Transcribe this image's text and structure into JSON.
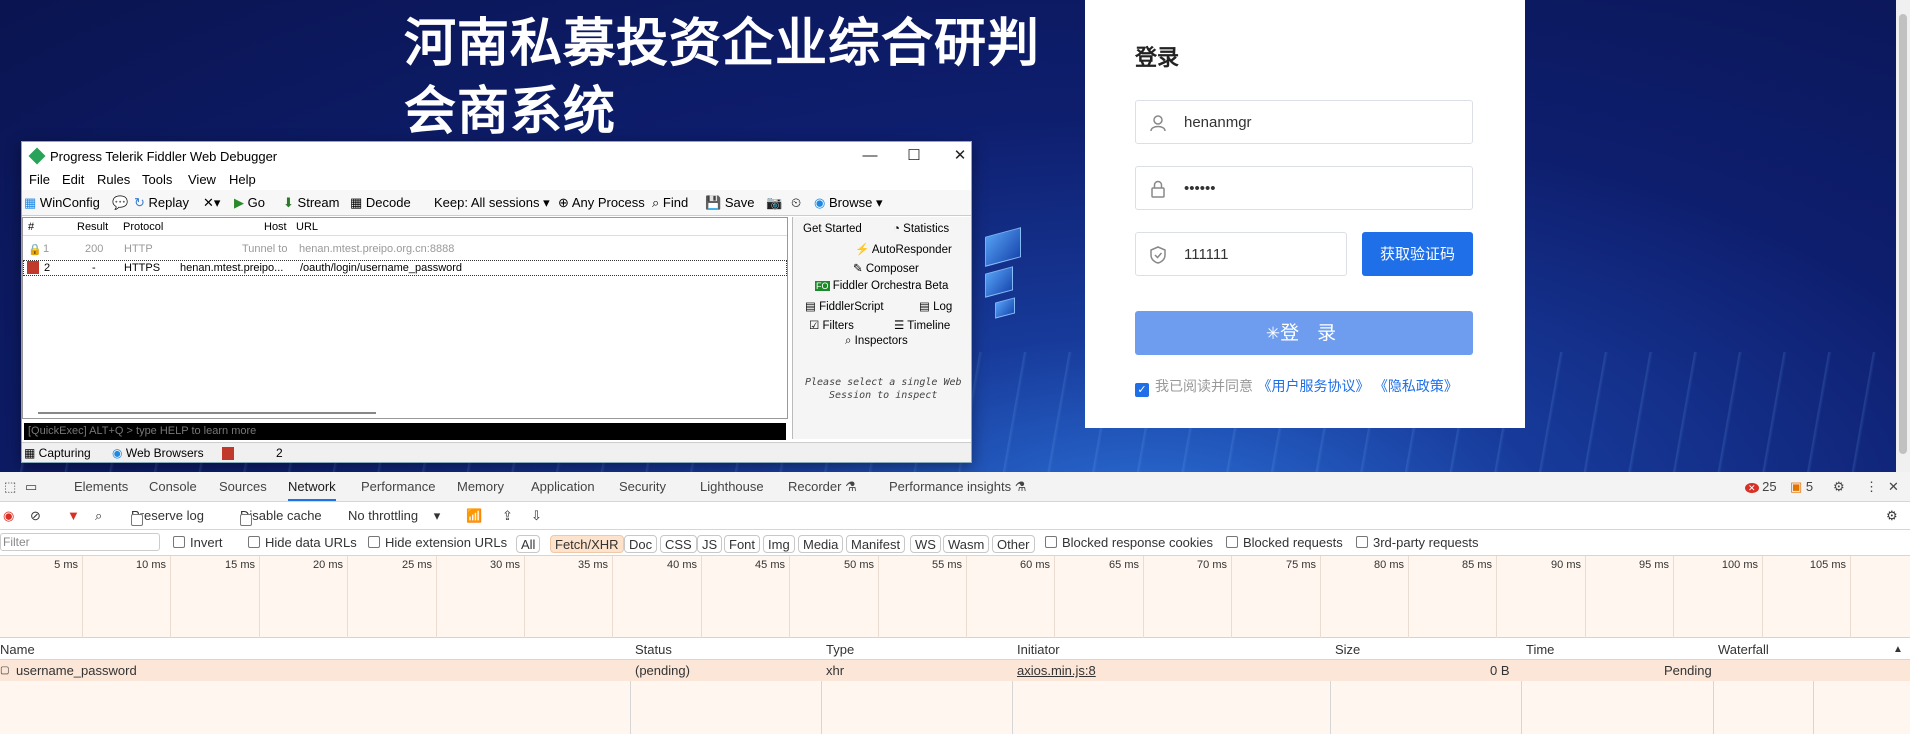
{
  "site": {
    "title_line1": "河南私募投资企业综合研判",
    "title_line2": "会商系统",
    "login": {
      "title": "登录",
      "username": "henanmgr",
      "password": "••••••",
      "captcha": "111111",
      "get_code_label": "获取验证码",
      "login_label": "登 录",
      "agree_text": "我已阅读并同意",
      "agreement_link": "《用户服务协议》",
      "privacy_link": "《隐私政策》"
    }
  },
  "fiddler": {
    "title": "Progress Telerik Fiddler Web Debugger",
    "menu": [
      "File",
      "Edit",
      "Rules",
      "Tools",
      "View",
      "Help"
    ],
    "toolbar": {
      "winconfig": "WinConfig",
      "replay": "Replay",
      "go": "Go",
      "stream": "Stream",
      "decode": "Decode",
      "keep": "Keep: All sessions",
      "any_process": "Any Process",
      "find": "Find",
      "save": "Save",
      "browse": "Browse"
    },
    "columns": [
      "#",
      "Result",
      "Protocol",
      "Host",
      "URL"
    ],
    "sessions": [
      {
        "num": "1",
        "result": "200",
        "protocol": "HTTP",
        "host": "Tunnel to",
        "url": "henan.mtest.preipo.org.cn:8888"
      },
      {
        "num": "2",
        "result": "-",
        "protocol": "HTTPS",
        "host": "henan.mtest.preipo...",
        "url": "/oauth/login/username_password"
      }
    ],
    "right_panel": {
      "get_started": "Get Started",
      "statistics": "Statistics",
      "autoresponder": "AutoResponder",
      "composer": "Composer",
      "orchestra": "Fiddler Orchestra Beta",
      "fiddlerscript": "FiddlerScript",
      "log": "Log",
      "filters": "Filters",
      "timeline": "Timeline",
      "inspectors": "Inspectors",
      "hint_line1": "Please select a single Web",
      "hint_line2": "Session to inspect"
    },
    "quickexec": "[QuickExec] ALT+Q > type HELP to learn more",
    "status": {
      "capturing": "Capturing",
      "browsers": "Web Browsers",
      "count": "2"
    }
  },
  "devtools": {
    "tabs": [
      "Elements",
      "Console",
      "Sources",
      "Network",
      "Performance",
      "Memory",
      "Application",
      "Security",
      "Lighthouse",
      "Recorder",
      "Performance insights"
    ],
    "active_tab": "Network",
    "errors": "25",
    "warnings": "5",
    "toolbar": {
      "preserve_log": "Preserve log",
      "disable_cache": "Disable cache",
      "throttling": "No throttling"
    },
    "filter": {
      "placeholder": "Filter",
      "invert": "Invert",
      "hide_data_urls": "Hide data URLs",
      "hide_extension_urls": "Hide extension URLs",
      "types": [
        "All",
        "Fetch/XHR",
        "Doc",
        "CSS",
        "JS",
        "Font",
        "Img",
        "Media",
        "Manifest",
        "WS",
        "Wasm",
        "Other"
      ],
      "selected_type": "Fetch/XHR",
      "blocked_cookies": "Blocked response cookies",
      "blocked_requests": "Blocked requests",
      "third_party": "3rd-party requests"
    },
    "ticks": [
      "5 ms",
      "10 ms",
      "15 ms",
      "20 ms",
      "25 ms",
      "30 ms",
      "35 ms",
      "40 ms",
      "45 ms",
      "50 ms",
      "55 ms",
      "60 ms",
      "65 ms",
      "70 ms",
      "75 ms",
      "80 ms",
      "85 ms",
      "90 ms",
      "95 ms",
      "100 ms",
      "105 ms"
    ],
    "columns": [
      "Name",
      "Status",
      "Type",
      "Initiator",
      "Size",
      "Time",
      "Waterfall"
    ],
    "rows": [
      {
        "name": "username_password",
        "status": "(pending)",
        "type": "xhr",
        "initiator": "axios.min.js:8",
        "size": "0 B",
        "time": "Pending"
      }
    ]
  }
}
